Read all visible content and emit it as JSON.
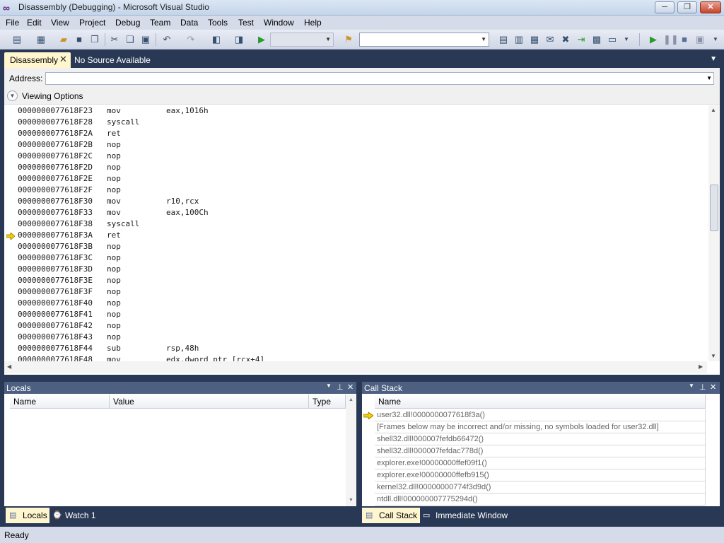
{
  "window": {
    "title": "Disassembly (Debugging) - Microsoft Visual Studio",
    "minimize": "─",
    "restore": "❐",
    "close": "✕"
  },
  "menu": [
    "File",
    "Edit",
    "View",
    "Project",
    "Debug",
    "Team",
    "Data",
    "Tools",
    "Test",
    "Window",
    "Help"
  ],
  "document_tabs": {
    "active": "Disassembly",
    "close_glyph": "✕",
    "other": "No Source Available"
  },
  "disassembly": {
    "address_label": "Address:",
    "address_value": "",
    "viewing_options": "Viewing Options",
    "current_instruction_index": 11,
    "rows": [
      {
        "addr": "0000000077618F23",
        "mnemonic": "mov",
        "operands": "eax,1016h"
      },
      {
        "addr": "0000000077618F28",
        "mnemonic": "syscall",
        "operands": ""
      },
      {
        "addr": "0000000077618F2A",
        "mnemonic": "ret",
        "operands": ""
      },
      {
        "addr": "0000000077618F2B",
        "mnemonic": "nop",
        "operands": ""
      },
      {
        "addr": "0000000077618F2C",
        "mnemonic": "nop",
        "operands": ""
      },
      {
        "addr": "0000000077618F2D",
        "mnemonic": "nop",
        "operands": ""
      },
      {
        "addr": "0000000077618F2E",
        "mnemonic": "nop",
        "operands": ""
      },
      {
        "addr": "0000000077618F2F",
        "mnemonic": "nop",
        "operands": ""
      },
      {
        "addr": "0000000077618F30",
        "mnemonic": "mov",
        "operands": "r10,rcx"
      },
      {
        "addr": "0000000077618F33",
        "mnemonic": "mov",
        "operands": "eax,100Ch"
      },
      {
        "addr": "0000000077618F38",
        "mnemonic": "syscall",
        "operands": ""
      },
      {
        "addr": "0000000077618F3A",
        "mnemonic": "ret",
        "operands": ""
      },
      {
        "addr": "0000000077618F3B",
        "mnemonic": "nop",
        "operands": ""
      },
      {
        "addr": "0000000077618F3C",
        "mnemonic": "nop",
        "operands": ""
      },
      {
        "addr": "0000000077618F3D",
        "mnemonic": "nop",
        "operands": ""
      },
      {
        "addr": "0000000077618F3E",
        "mnemonic": "nop",
        "operands": ""
      },
      {
        "addr": "0000000077618F3F",
        "mnemonic": "nop",
        "operands": ""
      },
      {
        "addr": "0000000077618F40",
        "mnemonic": "nop",
        "operands": ""
      },
      {
        "addr": "0000000077618F41",
        "mnemonic": "nop",
        "operands": ""
      },
      {
        "addr": "0000000077618F42",
        "mnemonic": "nop",
        "operands": ""
      },
      {
        "addr": "0000000077618F43",
        "mnemonic": "nop",
        "operands": ""
      },
      {
        "addr": "0000000077618F44",
        "mnemonic": "sub",
        "operands": "rsp,48h"
      },
      {
        "addr": "0000000077618F48",
        "mnemonic": "mov",
        "operands": "edx,dword ptr [rcx+4]"
      }
    ]
  },
  "locals": {
    "title": "Locals",
    "columns": [
      "Name",
      "Value",
      "Type"
    ]
  },
  "callstack": {
    "title": "Call Stack",
    "column": "Name",
    "frames": [
      "user32.dll!0000000077618f3a()",
      "[Frames below may be incorrect and/or missing, no symbols loaded for user32.dll]",
      "shell32.dll!000007fefdb66472()",
      "shell32.dll!000007fefdac778d()",
      "explorer.exe!00000000ffef09f1()",
      "explorer.exe!00000000ffefb915()",
      "kernel32.dll!00000000774f3d9d()",
      "ntdll.dll!000000007775294d()"
    ]
  },
  "bottom_tabs": {
    "left": [
      "Locals",
      "Watch 1"
    ],
    "right": [
      "Call Stack",
      "Immediate Window"
    ]
  },
  "status": "Ready",
  "colors": {
    "ide_background": "#293955",
    "tool_header": "#4d6082",
    "active_tab": "#fff6cf",
    "current_instruction_arrow": "#f2d000"
  }
}
